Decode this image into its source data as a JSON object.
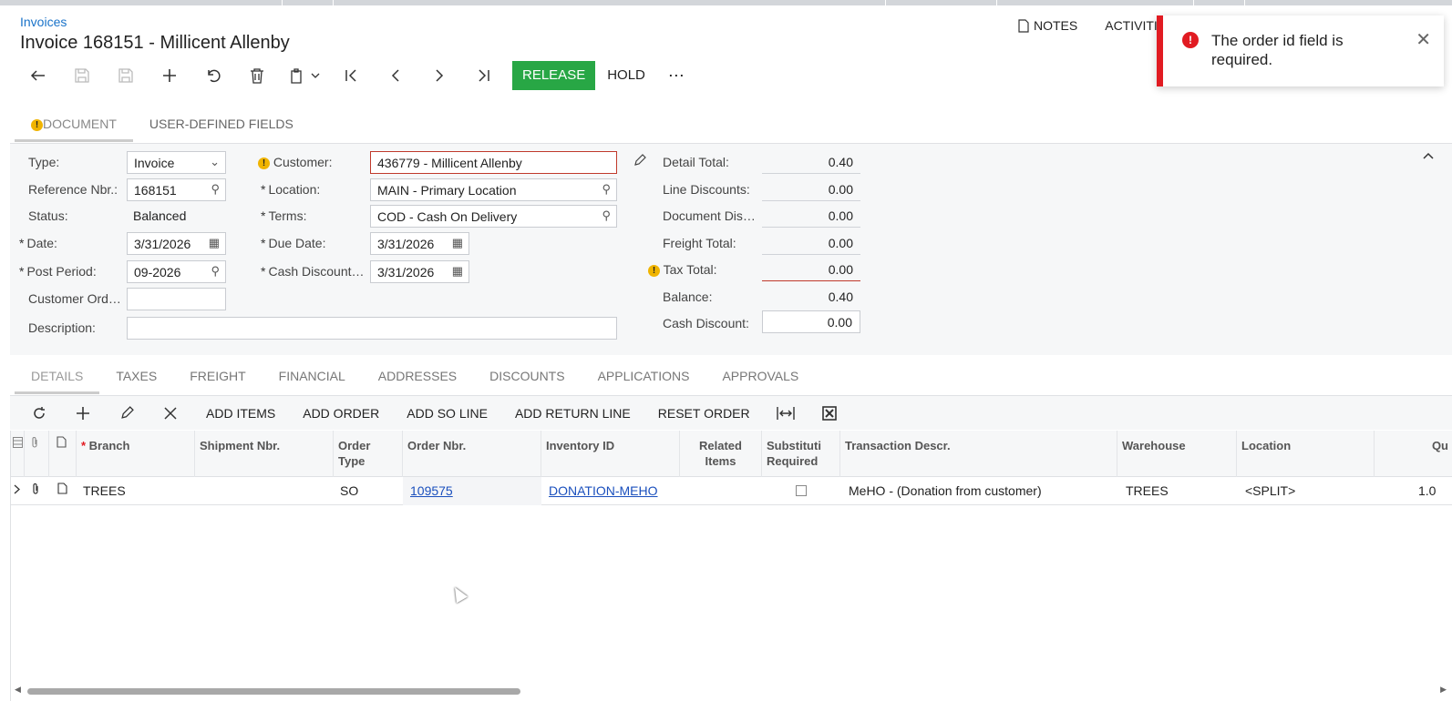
{
  "breadcrumb": "Invoices",
  "title": "Invoice 168151 - Millicent Allenby",
  "top_links": {
    "notes": "NOTES",
    "activities": "ACTIVITI"
  },
  "toast": {
    "message": "The order id field is required."
  },
  "toolbar": {
    "release": "RELEASE",
    "hold": "HOLD",
    "more": "⋯"
  },
  "tabs": {
    "document": "DOCUMENT",
    "user_defined": "USER-DEFINED FIELDS"
  },
  "form": {
    "type_label": "Type:",
    "type_value": "Invoice",
    "ref_label": "Reference Nbr.:",
    "ref_value": "168151",
    "status_label": "Status:",
    "status_value": "Balanced",
    "date_label": "Date:",
    "date_value": "3/31/2026",
    "post_period_label": "Post Period:",
    "post_period_value": "09-2026",
    "customer_ord_label": "Customer Ord…",
    "customer_ord_value": "",
    "description_label": "Description:",
    "description_value": "",
    "customer_label": "Customer:",
    "customer_value": "436779 - Millicent Allenby",
    "location_label": "Location:",
    "location_value": "MAIN - Primary Location",
    "terms_label": "Terms:",
    "terms_value": "COD - Cash On Delivery",
    "due_date_label": "Due Date:",
    "due_date_value": "3/31/2026",
    "cash_discount_date_label": "Cash Discount…",
    "cash_discount_date_value": "3/31/2026"
  },
  "totals": {
    "detail_total_label": "Detail Total:",
    "detail_total": "0.40",
    "line_discounts_label": "Line Discounts:",
    "line_discounts": "0.00",
    "document_dis_label": "Document Dis…",
    "document_dis": "0.00",
    "freight_total_label": "Freight Total:",
    "freight_total": "0.00",
    "tax_total_label": "Tax Total:",
    "tax_total": "0.00",
    "balance_label": "Balance:",
    "balance": "0.40",
    "cash_discount_label": "Cash Discount:",
    "cash_discount": "0.00"
  },
  "sub_tabs": [
    "DETAILS",
    "TAXES",
    "FREIGHT",
    "FINANCIAL",
    "ADDRESSES",
    "DISCOUNTS",
    "APPLICATIONS",
    "APPROVALS"
  ],
  "grid_toolbar": {
    "add_items": "ADD ITEMS",
    "add_order": "ADD ORDER",
    "add_so_line": "ADD SO LINE",
    "add_return_line": "ADD RETURN LINE",
    "reset_order": "RESET ORDER"
  },
  "grid": {
    "headers": {
      "branch": "Branch",
      "shipment_nbr": "Shipment Nbr.",
      "order_type_1": "Order",
      "order_type_2": "Type",
      "order_nbr": "Order Nbr.",
      "inventory_id": "Inventory ID",
      "related_1": "Related",
      "related_2": "Items",
      "subst_1": "Substituti",
      "subst_2": "Required",
      "descr": "Transaction Descr.",
      "warehouse": "Warehouse",
      "location": "Location",
      "qty": "Qu"
    },
    "row": {
      "branch": "TREES",
      "shipment_nbr": "",
      "order_type": "SO",
      "order_nbr": "109575",
      "inventory_id": "DONATION-MEHO",
      "related_items": "",
      "descr": "MeHO - (Donation from customer)",
      "warehouse": "TREES",
      "location": "<SPLIT>",
      "qty": "1.0"
    }
  }
}
